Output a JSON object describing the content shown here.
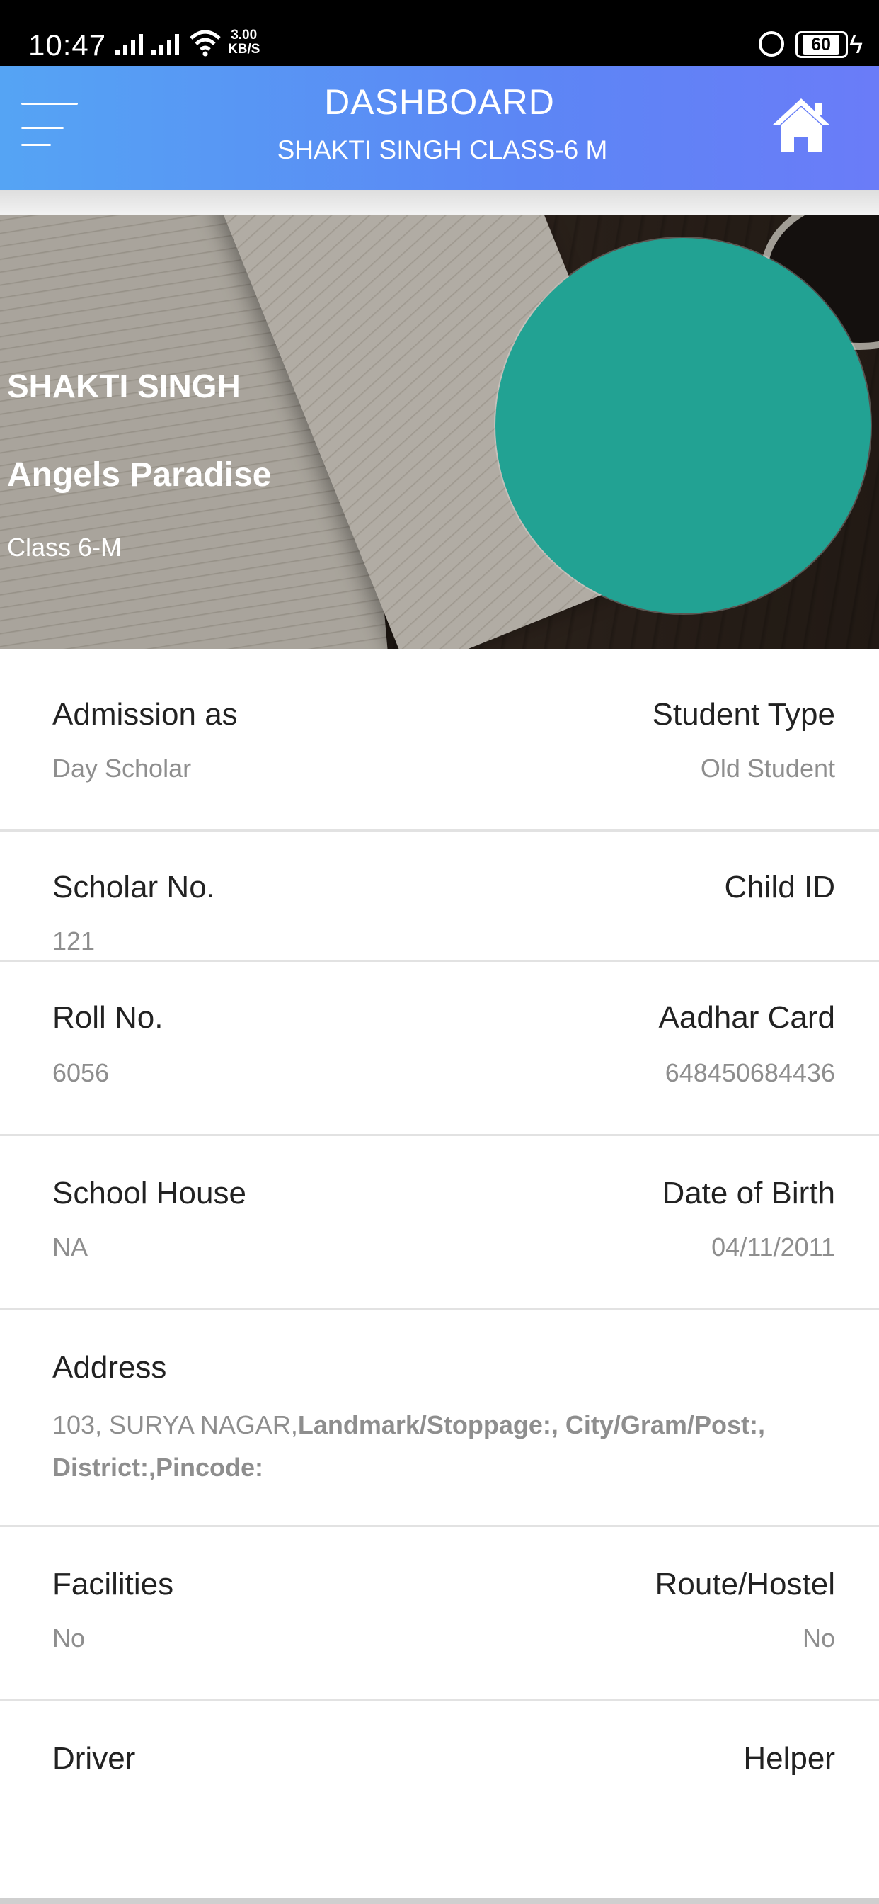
{
  "status_bar": {
    "time": "10:47",
    "net_speed_value": "3.00",
    "net_speed_unit": "KB/S",
    "battery": "60"
  },
  "app_bar": {
    "title": "DASHBOARD",
    "subtitle": "SHAKTI SINGH CLASS-6 M",
    "menu_icon": "hamburger-menu-icon",
    "home_icon": "home-icon"
  },
  "profile": {
    "name": "SHAKTI SINGH",
    "school": "Angels Paradise",
    "class": "Class 6-M",
    "avatar_color": "#22a293"
  },
  "details": {
    "admission": {
      "label": "Admission as",
      "value": "Day Scholar"
    },
    "student_type": {
      "label": "Student Type",
      "value": "Old Student"
    },
    "scholar_no": {
      "label": "Scholar No.",
      "value": "121"
    },
    "child_id": {
      "label": "Child ID",
      "value": ""
    },
    "roll_no": {
      "label": "Roll No.",
      "value": "6056"
    },
    "aadhar": {
      "label": "Aadhar Card",
      "value": "648450684436"
    },
    "school_house": {
      "label": "School House",
      "value": "NA"
    },
    "dob": {
      "label": "Date of Birth",
      "value": "04/11/2011"
    },
    "address": {
      "label": "Address",
      "line": "103, SURYA NAGAR,",
      "landmark": "Landmark/Stoppage:, City/Gram/Post:, District:,Pincode:"
    },
    "facilities": {
      "label": "Facilities",
      "value": "No"
    },
    "route_hostel": {
      "label": "Route/Hostel",
      "value": "No"
    },
    "driver": {
      "label": "Driver",
      "value": ""
    },
    "helper": {
      "label": "Helper",
      "value": ""
    }
  },
  "colors": {
    "app_bar_start": "#55a4f4",
    "app_bar_end": "#6a7cf8",
    "avatar": "#22a293"
  }
}
